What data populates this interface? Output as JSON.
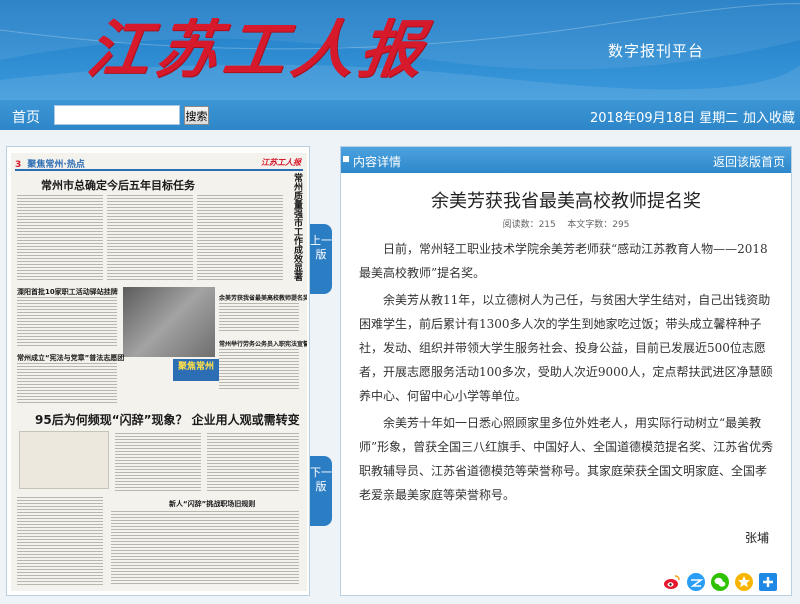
{
  "header": {
    "logo_text": "江苏工人报",
    "platform_title": "数字报刊平台"
  },
  "nav": {
    "home": "首页",
    "search_placeholder": "",
    "search_button": "搜索",
    "date": "2018年09月18日 星期二",
    "add_favorite": "加入收藏"
  },
  "newspaper": {
    "page_number": "3",
    "section": "聚焦常州·热点",
    "mini_logo": "江苏工人报",
    "headline_main": "常州市总确定今后五年目标任务",
    "headline_2": "溧阳首批10家职工活动驿站挂牌",
    "headline_3": "常州成立“宪法与党章”普法志愿团",
    "headline_4": "95后为何频现“闪辞”现象？ 企业用人观或需转变",
    "headline_5": "新人“闪辞”挑战职场旧规则",
    "side_vertical": "常州质量强市工作成效显著",
    "sub_1": "余美芳获我省最美高校教师提名奖",
    "sub_2": "常州举行劳务公务员入职宪法宣誓",
    "banner": "聚焦常州",
    "prev_page": "上一版",
    "next_page": "下一版"
  },
  "article": {
    "bar_label": "内容详情",
    "back_link": "返回该版首页",
    "title": "余美芳获我省最美高校教师提名奖",
    "read_count": "阅读数：215",
    "word_count": "本文字数：295",
    "paragraphs": [
      "日前，常州轻工职业技术学院余美芳老师获“感动江苏教育人物——2018最美高校教师”提名奖。",
      "余美芳从教11年，以立德树人为己任，与贫困大学生结对，自己出钱资助困难学生，前后累计有1300多人次的学生到她家吃过饭；带头成立馨梓种子社，发动、组织并带领大学生服务社会、投身公益，目前已发展近500位志愿者，开展志愿服务活动100多次，受助人次近9000人，定点帮扶武进区净慧颐养中心、何留中心小学等单位。",
      "余美芳十年如一日悉心照顾家里多位外姓老人，用实际行动树立“最美教师”形象，曾获全国三八红旗手、中国好人、全国道德模范提名奖、江苏省优秀职教辅导员、江苏省道德模范等荣誉称号。其家庭荣获全国文明家庭、全国孝老爱亲最美家庭等荣誉称号。"
    ],
    "author": "张埔"
  },
  "share": {
    "icons": [
      "weibo-icon",
      "qzone-icon",
      "wechat-icon",
      "favorite-star-icon",
      "more-share-icon"
    ]
  },
  "colors": {
    "brand_blue": "#2d87c9",
    "logo_red": "#d7192c"
  }
}
